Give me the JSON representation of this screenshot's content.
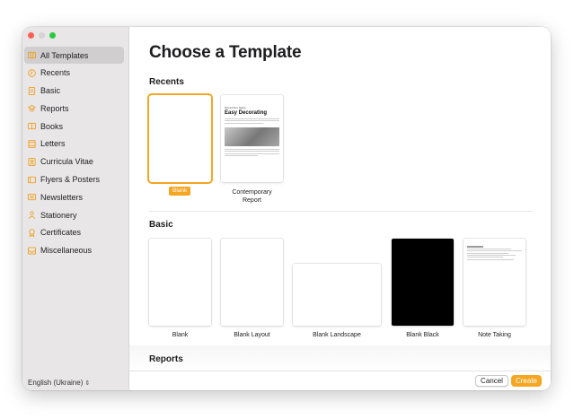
{
  "sidebar": {
    "items": [
      {
        "label": "All Templates",
        "icon": "all-templates-icon",
        "selected": true
      },
      {
        "label": "Recents",
        "icon": "clock-icon"
      },
      {
        "label": "Basic",
        "icon": "document-icon"
      },
      {
        "label": "Reports",
        "icon": "reports-icon"
      },
      {
        "label": "Books",
        "icon": "book-icon"
      },
      {
        "label": "Letters",
        "icon": "letter-icon"
      },
      {
        "label": "Curricula Vitae",
        "icon": "person-card-icon"
      },
      {
        "label": "Flyers & Posters",
        "icon": "flyer-icon"
      },
      {
        "label": "Newsletters",
        "icon": "newsletter-icon"
      },
      {
        "label": "Stationery",
        "icon": "stationery-icon"
      },
      {
        "label": "Certificates",
        "icon": "ribbon-icon"
      },
      {
        "label": "Miscellaneous",
        "icon": "tray-icon"
      }
    ],
    "language": "English (Ukraine)"
  },
  "main": {
    "title": "Choose a Template",
    "recents": {
      "heading": "Recents",
      "items": [
        {
          "label": "Blank",
          "selected": true
        },
        {
          "label": "Contemporary\nReport"
        }
      ]
    },
    "contemporary_preview": {
      "kicker": "Sheets Home Styling",
      "title": "Easy Decorating"
    },
    "basic": {
      "heading": "Basic",
      "items": [
        {
          "label": "Blank"
        },
        {
          "label": "Blank Layout"
        },
        {
          "label": "Blank Landscape"
        },
        {
          "label": "Blank Black"
        },
        {
          "label": "Note Taking"
        }
      ]
    },
    "reports": {
      "heading": "Reports"
    }
  },
  "footer": {
    "cancel_label": "Cancel",
    "create_label": "Create"
  },
  "colors": {
    "accent": "#f5a623",
    "sidebar_bg": "#e8e6e7",
    "selected_row": "#d0cecf"
  }
}
